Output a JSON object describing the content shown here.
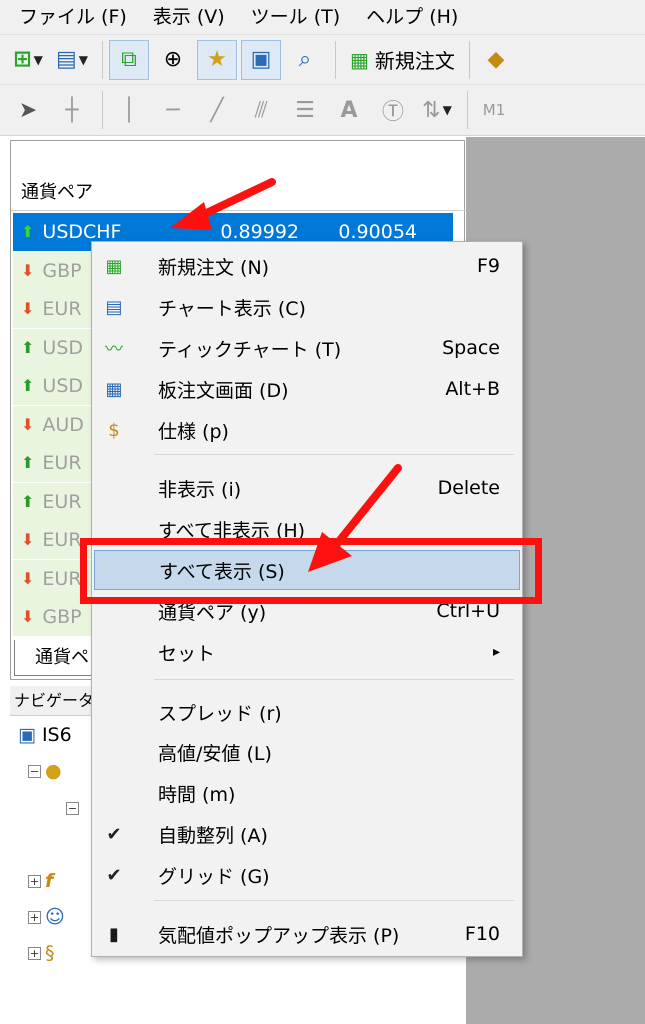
{
  "menubar": [
    "ファイル (F)",
    "表示 (V)",
    "ツール (T)",
    "ヘルプ (H)"
  ],
  "toolbar": {
    "new_order_label": "新規注文",
    "period_label": "M1"
  },
  "market_watch": {
    "header": "通貨ペア",
    "tab_label": "通貨ペア",
    "rows": [
      {
        "symbol": "USDCHF",
        "bid": "0.89992",
        "ask": "0.90054",
        "dir": "up",
        "selected": true
      },
      {
        "symbol": "GBP",
        "dir": "down"
      },
      {
        "symbol": "EUR",
        "dir": "down"
      },
      {
        "symbol": "USD",
        "dir": "up"
      },
      {
        "symbol": "USD",
        "dir": "up"
      },
      {
        "symbol": "AUD",
        "dir": "down"
      },
      {
        "symbol": "EUR",
        "dir": "up"
      },
      {
        "symbol": "EUR",
        "dir": "up"
      },
      {
        "symbol": "EUR",
        "dir": "down"
      },
      {
        "symbol": "EUR",
        "dir": "down"
      },
      {
        "symbol": "GBP",
        "dir": "down"
      }
    ]
  },
  "navigator": {
    "header": "ナビゲータ",
    "root": "IS6"
  },
  "context_menu": {
    "items": [
      {
        "label": "新規注文 (N)",
        "shortcut": "F9",
        "icon": "new-order-icon"
      },
      {
        "label": "チャート表示 (C)",
        "shortcut": "",
        "icon": "chart-window-icon"
      },
      {
        "label": "ティックチャート (T)",
        "shortcut": "Space",
        "icon": "tick-chart-icon"
      },
      {
        "label": "板注文画面 (D)",
        "shortcut": "Alt+B",
        "icon": "depth-of-market-icon"
      },
      {
        "label": "仕様 (p)",
        "shortcut": "",
        "icon": "dollar-icon"
      },
      {
        "label": "非表示 (i)",
        "shortcut": "Delete",
        "icon": ""
      },
      {
        "label": "すべて非表示 (H)",
        "shortcut": "",
        "icon": ""
      },
      {
        "label": "すべて表示 (S)",
        "shortcut": "",
        "icon": "",
        "highlighted": true
      },
      {
        "label": "通貨ペア (y)",
        "shortcut": "Ctrl+U",
        "icon": ""
      },
      {
        "label": "セット",
        "shortcut": "▸",
        "icon": ""
      },
      {
        "label": "スプレッド (r)",
        "shortcut": "",
        "icon": ""
      },
      {
        "label": "高値/安値 (L)",
        "shortcut": "",
        "icon": ""
      },
      {
        "label": "時間 (m)",
        "shortcut": "",
        "icon": ""
      },
      {
        "label": "自動整列 (A)",
        "shortcut": "",
        "icon": "check-icon"
      },
      {
        "label": "グリッド (G)",
        "shortcut": "",
        "icon": "check-icon"
      },
      {
        "label": "気配値ポップアップ表示 (P)",
        "shortcut": "F10",
        "icon": "popup-prices-icon"
      }
    ]
  },
  "colors": {
    "annotation": "#ff1010",
    "selection": "#0078d7",
    "highlight": "#c6d9ec"
  }
}
